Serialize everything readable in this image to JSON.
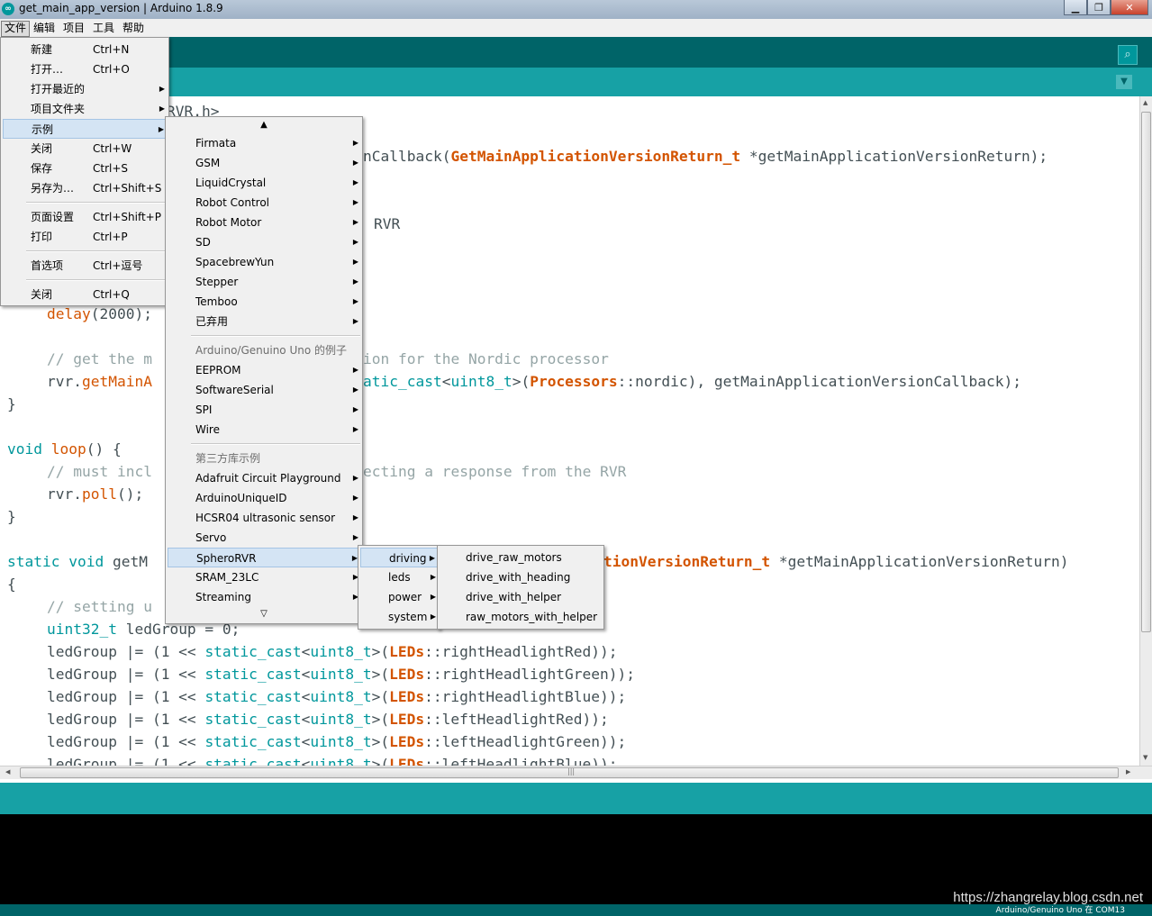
{
  "window": {
    "title": "get_main_app_version | Arduino 1.8.9",
    "controls": [
      "▁",
      "❐",
      "✕"
    ]
  },
  "menubar": [
    "文件",
    "编辑",
    "项目",
    "工具",
    "帮助"
  ],
  "file_menu": {
    "items": [
      {
        "label": "新建",
        "shortcut": "Ctrl+N"
      },
      {
        "label": "打开…",
        "shortcut": "Ctrl+O"
      },
      {
        "label": "打开最近的",
        "shortcut": ""
      },
      {
        "label": "项目文件夹",
        "shortcut": ""
      },
      {
        "label": "示例",
        "shortcut": ""
      },
      {
        "label": "关闭",
        "shortcut": "Ctrl+W"
      },
      {
        "label": "保存",
        "shortcut": "Ctrl+S"
      },
      {
        "label": "另存为…",
        "shortcut": "Ctrl+Shift+S"
      },
      {
        "label": "页面设置",
        "shortcut": "Ctrl+Shift+P"
      },
      {
        "label": "打印",
        "shortcut": "Ctrl+P"
      },
      {
        "label": "首选项",
        "shortcut": "Ctrl+逗号"
      },
      {
        "label": "关闭",
        "shortcut": "Ctrl+Q"
      }
    ]
  },
  "examples_menu": {
    "scroll_up": "▲",
    "scroll_down": "▽",
    "items": [
      {
        "label": "Firmata"
      },
      {
        "label": "GSM"
      },
      {
        "label": "LiquidCrystal"
      },
      {
        "label": "Robot Control"
      },
      {
        "label": "Robot Motor"
      },
      {
        "label": "SD"
      },
      {
        "label": "SpacebrewYun"
      },
      {
        "label": "Stepper"
      },
      {
        "label": "Temboo"
      },
      {
        "label": "已弃用"
      },
      {
        "label": "Arduino/Genuino Uno 的例子"
      },
      {
        "label": "EEPROM"
      },
      {
        "label": "SoftwareSerial"
      },
      {
        "label": "SPI"
      },
      {
        "label": "Wire"
      },
      {
        "label": "第三方库示例"
      },
      {
        "label": "Adafruit Circuit Playground"
      },
      {
        "label": "ArduinoUniqueID"
      },
      {
        "label": "HCSR04 ultrasonic sensor"
      },
      {
        "label": "Servo"
      },
      {
        "label": "SpheroRVR"
      },
      {
        "label": "SRAM_23LC"
      },
      {
        "label": "Streaming"
      }
    ]
  },
  "rvr_menu": {
    "items": [
      {
        "label": "driving"
      },
      {
        "label": "leds"
      },
      {
        "label": "power"
      },
      {
        "label": "system"
      }
    ]
  },
  "driving_menu": {
    "items": [
      {
        "label": "drive_raw_motors"
      },
      {
        "label": "drive_with_heading"
      },
      {
        "label": "drive_with_helper"
      },
      {
        "label": "raw_motors_with_helper"
      }
    ]
  },
  "code": {
    "l1": "RVR.h>",
    "l2a": "nCallback(",
    "l2b": "GetMainApplicationVersionReturn_t",
    "l2c": " *getMainApplicationVersionReturn);",
    "l3": "RVR",
    "l4a": "delay",
    "l4b": "(2000);",
    "l5": "// get the m",
    "l5b": "ion for the Nordic processor",
    "l6a": "rvr.",
    "l6b": "getMainA",
    "l6c": "atic_cast",
    "l6d": "<",
    "l6e": "uint8_t",
    "l6f": ">(",
    "l6g": "Processors",
    "l6h": "::nordic), getMainApplicationVersionCallback);",
    "l7": "}",
    "l8a": "void",
    "l8b": " ",
    "l8c": "loop",
    "l8d": "() {",
    "l9": "// must incl",
    "l9b": "ecting a response from the RVR",
    "l10a": "rvr.",
    "l10b": "poll",
    "l10c": "();",
    "l11": "}",
    "l12a": "static",
    "l12b": " ",
    "l12c": "void",
    "l12d": " getM",
    "l12e": "tionVersionReturn_t",
    "l12f": " *getMainApplicationVersionReturn)",
    "l13": "{",
    "l14": "// setting u",
    "l15a": "uint32_t",
    "l15b": " ledGroup = 0;",
    "lg": "ledGroup |= (1 << ",
    "sc": "static_cast",
    "u8": "uint8_t",
    "leds": "LEDs",
    "r16": "::rightHeadlightRed));",
    "r17": "::rightHeadlightGreen));",
    "r18": "::rightHeadlightBlue));",
    "r19": "::leftHeadlightRed));",
    "r20": "::leftHeadlightGreen));",
    "r21": "::leftHeadlightBlue));"
  },
  "status": {
    "board_port": "Arduino/Genuino Uno 在 COM13"
  },
  "watermark": "https://zhangrelay.blog.csdn.net",
  "colors": {
    "teal_dark": "#006468",
    "teal": "#17a1a5",
    "keyword": "#d35400",
    "type": "#00979c",
    "comment": "#95a5a6"
  }
}
